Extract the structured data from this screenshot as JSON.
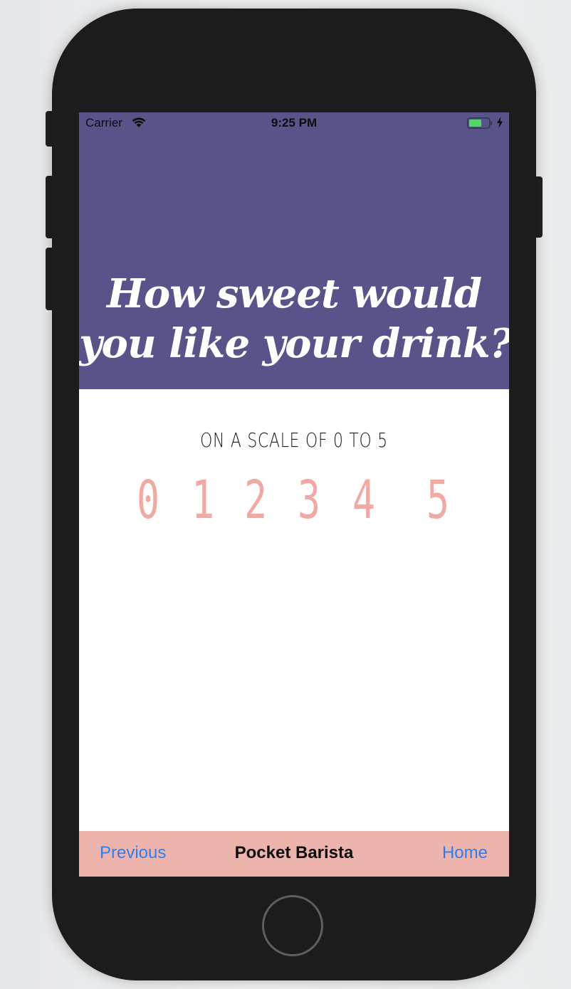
{
  "status_bar": {
    "carrier": "Carrier",
    "time": "9:25 PM",
    "wifi_icon": "wifi-icon",
    "battery_icon": "battery-icon",
    "charging_icon": "charging-bolt-icon"
  },
  "header": {
    "line1": "How sweet would",
    "line2": "you like your drink?",
    "background_color": "#58548a"
  },
  "scale": {
    "caption": "ON A SCALE OF 0 TO 5",
    "options": [
      "0",
      "1",
      "2",
      "3",
      "4",
      "5"
    ],
    "option_color": "#f0aaa3"
  },
  "tab_bar": {
    "previous_label": "Previous",
    "title": "Pocket Barista",
    "home_label": "Home",
    "background_color": "#edb4ae",
    "link_color": "#2f7ef0"
  }
}
